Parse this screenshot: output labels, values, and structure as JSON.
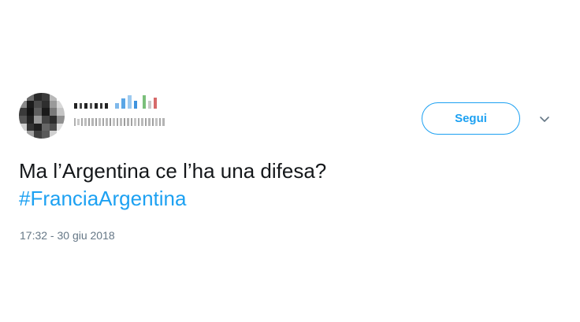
{
  "tweet": {
    "author": {
      "avatar_description": "pixelated-avatar",
      "name_icon": "pixelated-name",
      "handle_icon": "pixelated-handle"
    },
    "follow_label": "Segui",
    "menu_icon": "chevron-down-icon",
    "text": "Ma l’Argentina ce l’ha una difesa?",
    "hashtag": "#FranciaArgentina",
    "timestamp": "17:32 - 30 giu 2018"
  },
  "colors": {
    "accent": "#1da1f2",
    "text": "#14171a",
    "muted": "#657786"
  }
}
